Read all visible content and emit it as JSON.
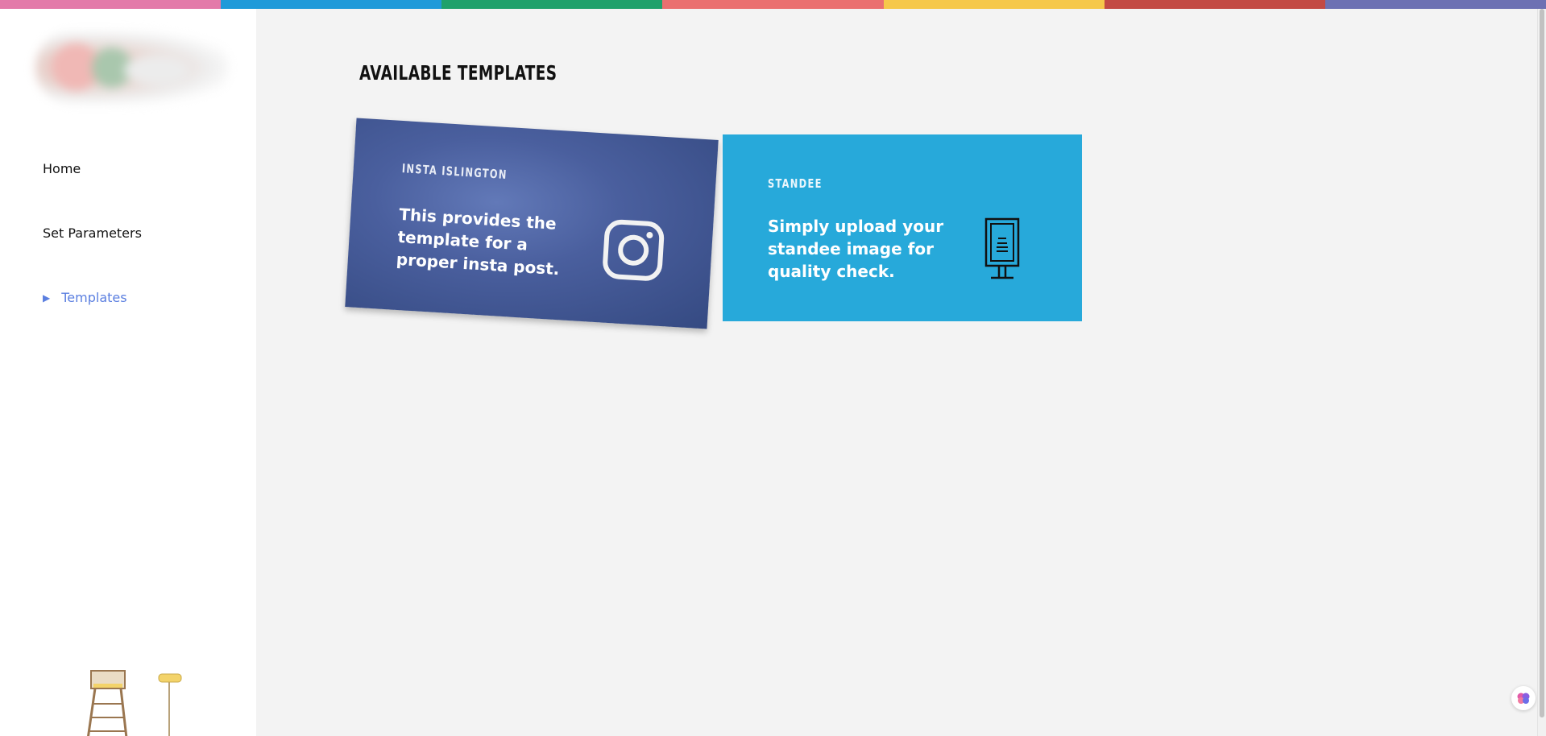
{
  "colors": {
    "top_bar": [
      "#e37aa9",
      "#1f9ad9",
      "#1fa16b",
      "#ea7070",
      "#f6c84a",
      "#c34a44",
      "#6d71b3"
    ],
    "sidebar_active": "#5b7fe0",
    "insta_card": "#465c9b",
    "standee_card": "#27a9da"
  },
  "sidebar": {
    "items": [
      {
        "label": "Home"
      },
      {
        "label": "Set Parameters"
      },
      {
        "label": "Templates",
        "active": true
      }
    ]
  },
  "main": {
    "title": "AVAILABLE TEMPLATES",
    "cards": [
      {
        "label": "INSTA ISLINGTON",
        "description": "This provides the template for a proper insta post.",
        "icon": "instagram-icon"
      },
      {
        "label": "STANDEE",
        "description": "Simply upload your standee image for quality check.",
        "icon": "standee-icon"
      }
    ]
  },
  "floating_button": {
    "icon": "brain-icon"
  }
}
